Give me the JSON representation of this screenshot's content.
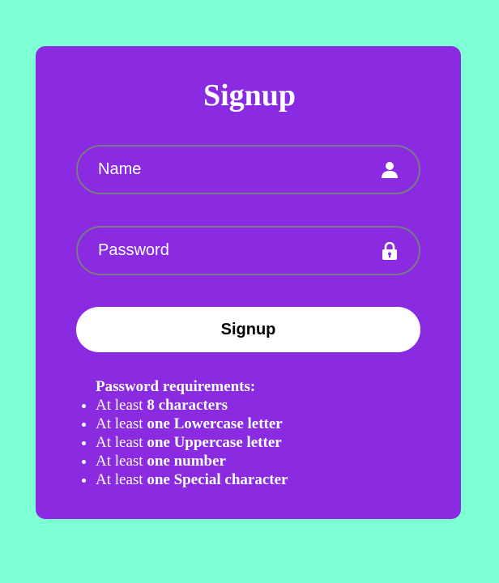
{
  "form": {
    "title": "Signup",
    "name_placeholder": "Name",
    "password_placeholder": "Password",
    "submit_label": "Signup"
  },
  "requirements": {
    "heading": "Password requirements:",
    "items": [
      {
        "prefix": "At least ",
        "emphasis": "8 characters"
      },
      {
        "prefix": "At least ",
        "emphasis": "one Lowercase letter"
      },
      {
        "prefix": "At least ",
        "emphasis": "one Uppercase letter"
      },
      {
        "prefix": "At least ",
        "emphasis": "one number"
      },
      {
        "prefix": "At least ",
        "emphasis": "one Special character"
      }
    ]
  },
  "icons": {
    "name_field": "user-icon",
    "password_field": "lock-icon"
  },
  "colors": {
    "background": "#7fffd4",
    "card": "#8a2be2",
    "field_border": "#7a7a86",
    "text": "#ffffff",
    "button_bg": "#ffffff",
    "button_text": "#000000"
  }
}
